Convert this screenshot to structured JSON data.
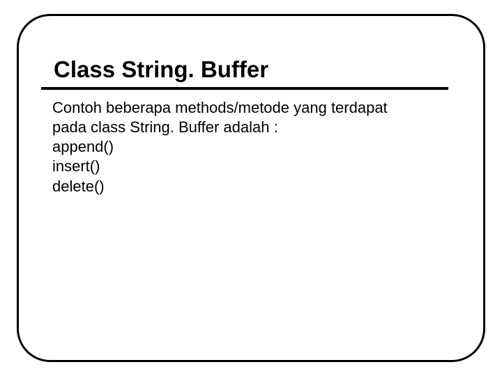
{
  "slide": {
    "title": "Class String. Buffer",
    "body": {
      "line1": "Contoh beberapa methods/metode yang terdapat",
      "line2": "pada class String. Buffer adalah :",
      "method1": "append()",
      "method2": "insert()",
      "method3": "delete()"
    }
  }
}
